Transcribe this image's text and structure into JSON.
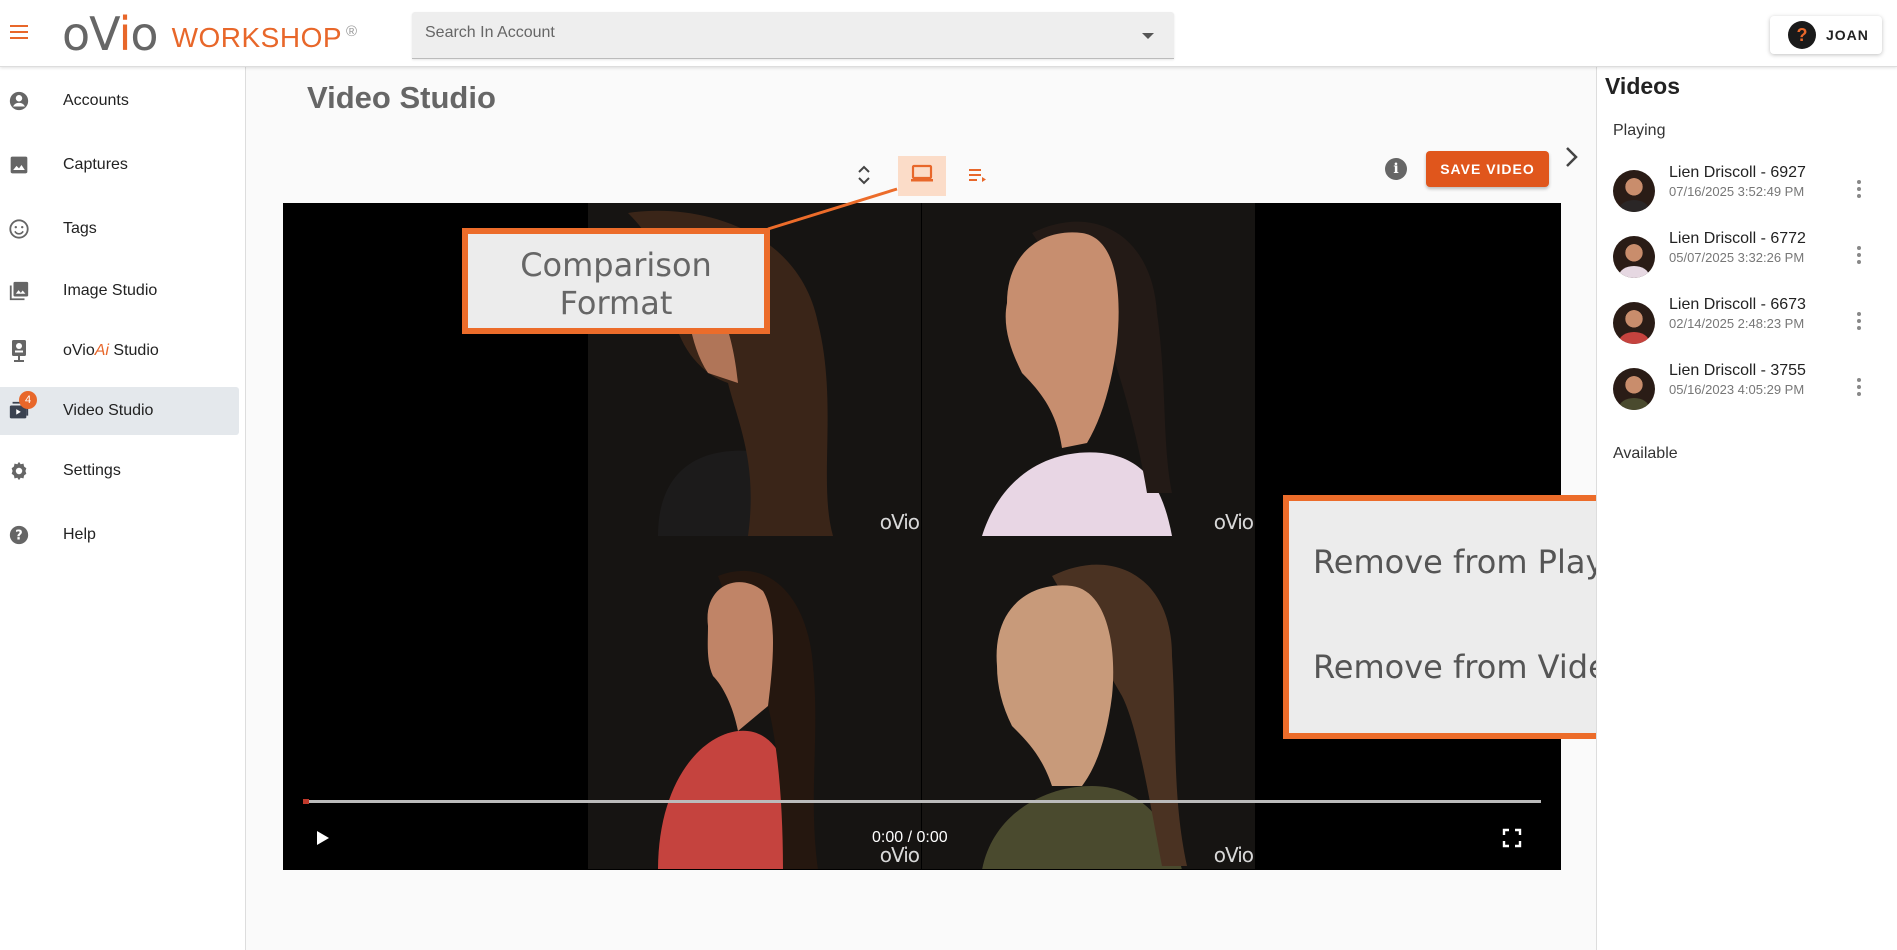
{
  "header": {
    "logo_main": "oVio",
    "logo_product": "WORKSHOP",
    "logo_reg": "®",
    "search_placeholder": "Search In Account",
    "user_initial": "?",
    "user_name": "JOAN"
  },
  "sidebar": {
    "items": [
      {
        "label": "Accounts",
        "icon": "account-circle-icon"
      },
      {
        "label": "Captures",
        "icon": "image-icon"
      },
      {
        "label": "Tags",
        "icon": "smiley-icon"
      },
      {
        "label": "Image Studio",
        "icon": "photo-library-icon"
      },
      {
        "label_prefix": "oVio",
        "label_ai": "Ai",
        "label_suffix": " Studio",
        "icon": "ovio-device-icon"
      },
      {
        "label": "Video Studio",
        "icon": "video-library-icon",
        "badge": "4",
        "active": true
      },
      {
        "label": "Settings",
        "icon": "gear-icon"
      },
      {
        "label": "Help",
        "icon": "help-icon"
      }
    ]
  },
  "main": {
    "title": "Video Studio",
    "save_label": "SAVE VIDEO",
    "info_glyph": "i",
    "video": {
      "time": "0:00 / 0:00",
      "watermark": "oVio",
      "progress": 0
    }
  },
  "callouts": {
    "comparison_line1": "Comparison",
    "comparison_line2": "Format",
    "remove_player": "Remove from Player",
    "remove_studio": "Remove from Video Studio"
  },
  "videos_panel": {
    "title": "Videos",
    "playing_label": "Playing",
    "available_label": "Available",
    "items": [
      {
        "title": "Lien Driscoll - 6927",
        "date": "07/16/2025 3:52:49 PM"
      },
      {
        "title": "Lien Driscoll - 6772",
        "date": "05/07/2025 3:32:26 PM"
      },
      {
        "title": "Lien Driscoll - 6673",
        "date": "02/14/2025 2:48:23 PM"
      },
      {
        "title": "Lien Driscoll - 3755",
        "date": "05/16/2023 4:05:29 PM"
      }
    ]
  },
  "colors": {
    "accent": "#e8672a",
    "save_button": "#e0561c",
    "callout_border": "#ec6c2a",
    "active_nav": "#e4e8ec"
  }
}
